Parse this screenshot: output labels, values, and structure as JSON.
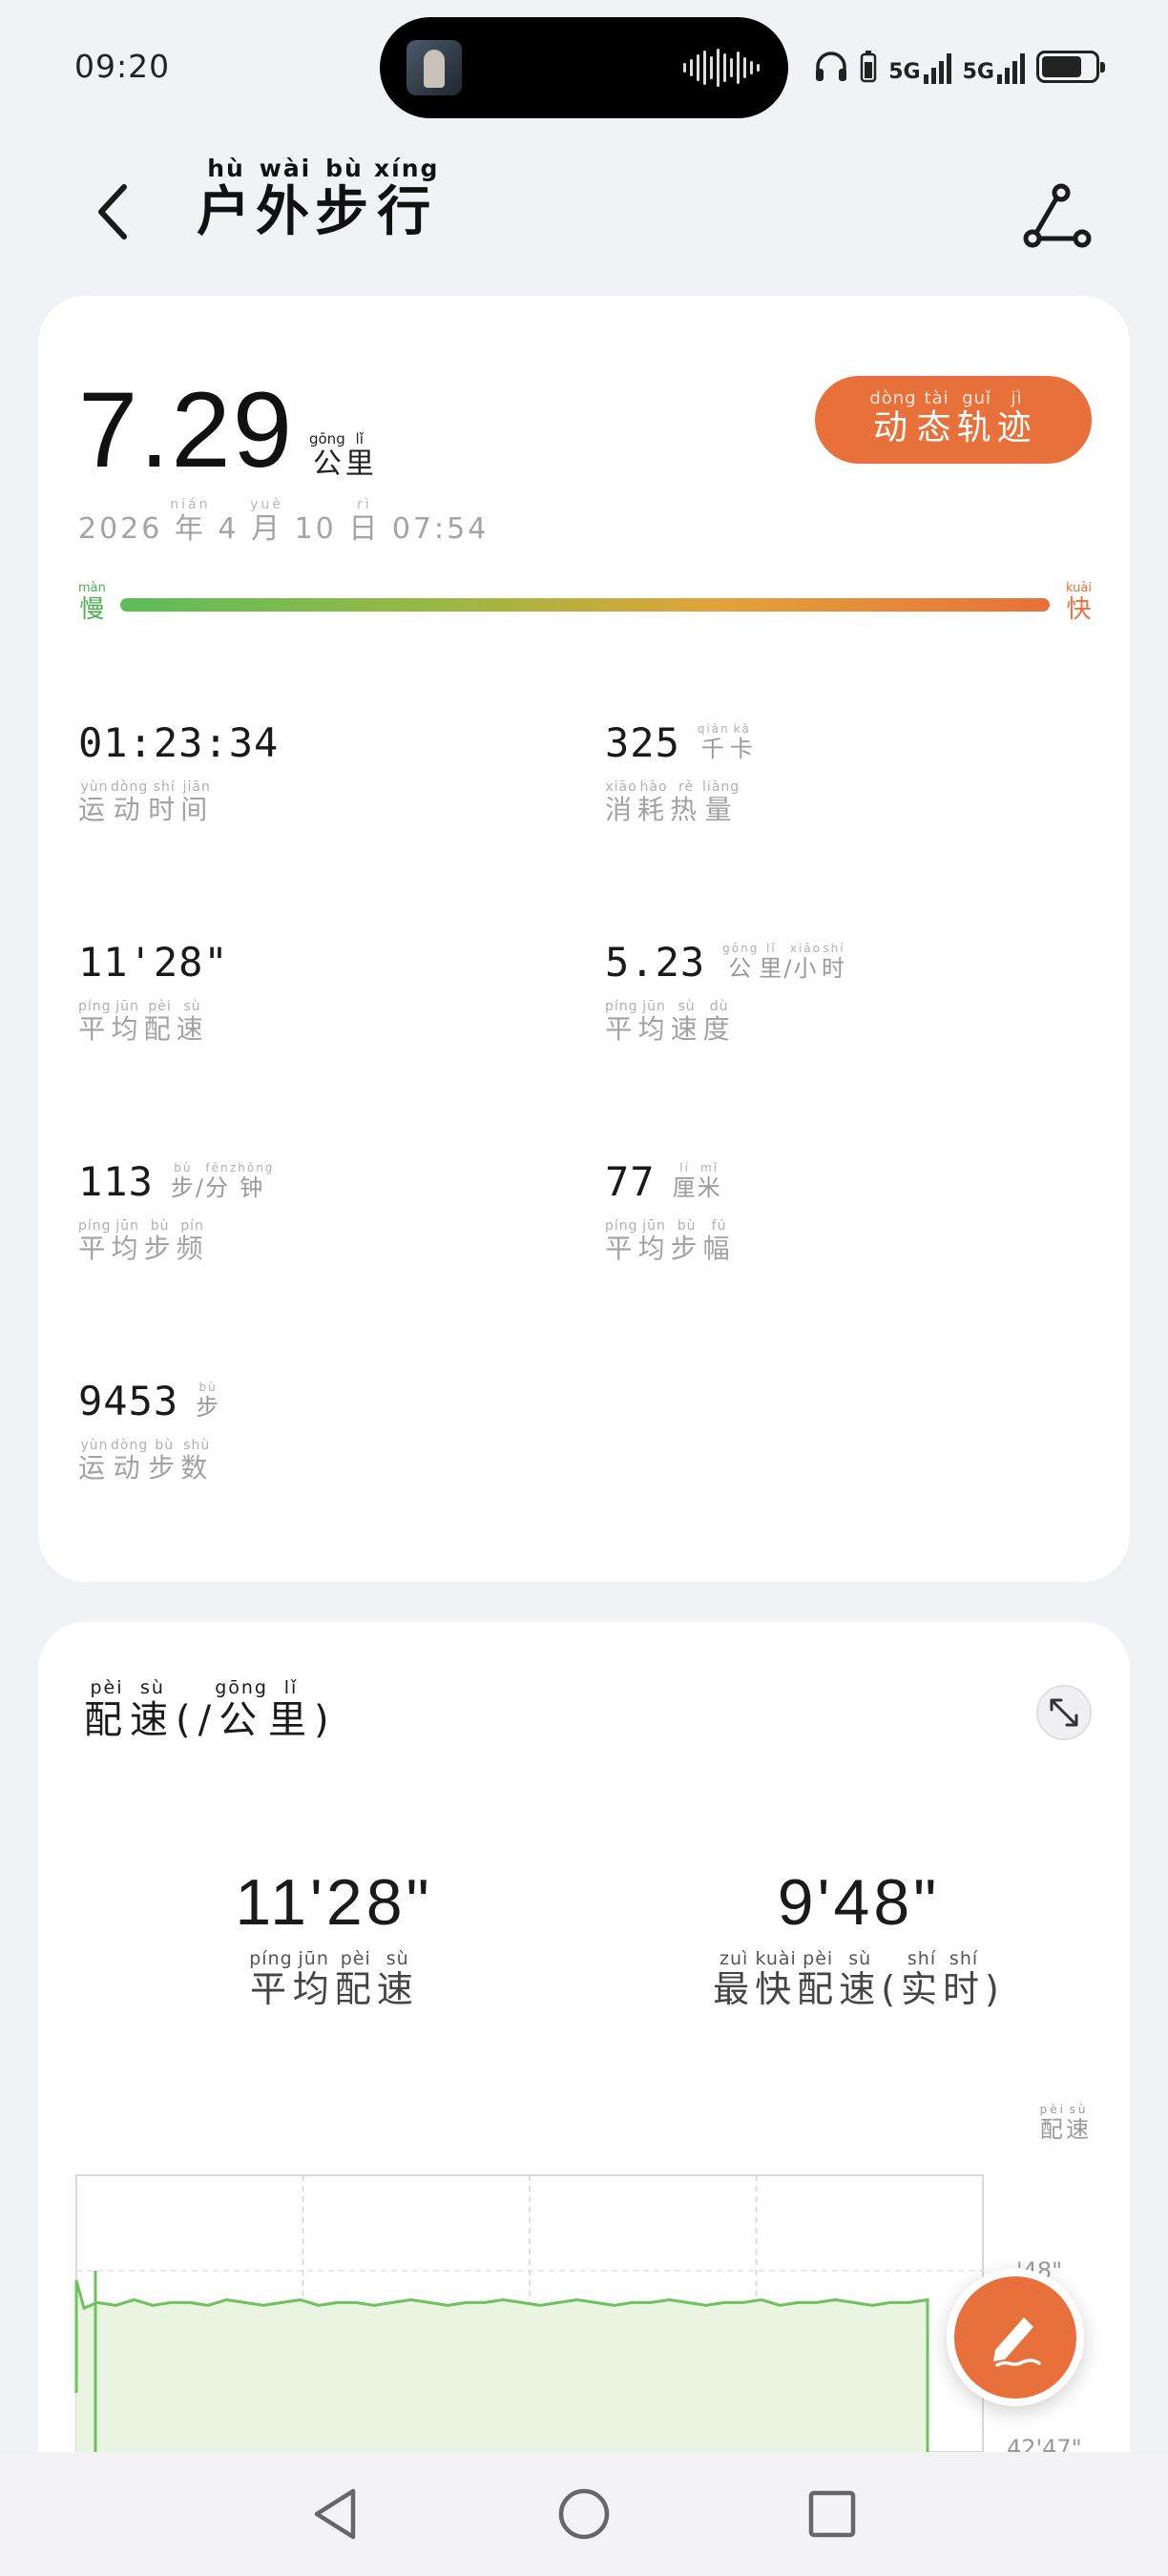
{
  "status_bar": {
    "time": "09:20",
    "network_1": "5G",
    "network_2": "5G",
    "battery_level": 0.75,
    "icons": [
      "headphones-icon",
      "battery-small-icon",
      "signal-icon",
      "signal-icon",
      "battery-icon"
    ]
  },
  "header": {
    "title": [
      {
        "char": "户",
        "pinyin": "hù"
      },
      {
        "char": "外",
        "pinyin": "wài"
      },
      {
        "char": "步",
        "pinyin": "bù"
      },
      {
        "char": "行",
        "pinyin": "xíng"
      }
    ],
    "back_icon": "chevron-left-icon",
    "share_icon": "route-share-icon"
  },
  "summary": {
    "distance": "7.29",
    "distance_unit": [
      {
        "char": "公",
        "pinyin": "gōng"
      },
      {
        "char": "里",
        "pinyin": "lǐ"
      }
    ],
    "track_button": [
      {
        "char": "动",
        "pinyin": "dòng"
      },
      {
        "char": "态",
        "pinyin": "tài"
      },
      {
        "char": "轨",
        "pinyin": "guǐ"
      },
      {
        "char": "迹",
        "pinyin": "jì"
      }
    ],
    "date": [
      {
        "char": "2026 ",
        "pinyin": ""
      },
      {
        "char": "年",
        "pinyin": "nián"
      },
      {
        "char": " 4 ",
        "pinyin": ""
      },
      {
        "char": "月",
        "pinyin": "yuè"
      },
      {
        "char": " 10 ",
        "pinyin": ""
      },
      {
        "char": "日",
        "pinyin": "rì"
      },
      {
        "char": " 07:54",
        "pinyin": ""
      }
    ],
    "speed_slow": {
      "char": "慢",
      "pinyin": "màn"
    },
    "speed_fast": {
      "char": "快",
      "pinyin": "kuài"
    },
    "colors": {
      "slow": "#4caf50",
      "fast": "#e8703a",
      "accent": "#e8703a"
    }
  },
  "metrics": [
    {
      "value": "01:23:34",
      "unit": [],
      "label": [
        {
          "char": "运",
          "pinyin": "yùn"
        },
        {
          "char": "动",
          "pinyin": "dòng"
        },
        {
          "char": "时",
          "pinyin": "shí"
        },
        {
          "char": "间",
          "pinyin": "jiān"
        }
      ]
    },
    {
      "value": "325",
      "unit": [
        {
          "char": "千",
          "pinyin": "qiān"
        },
        {
          "char": "卡",
          "pinyin": "kǎ"
        }
      ],
      "label": [
        {
          "char": "消",
          "pinyin": "xiāo"
        },
        {
          "char": "耗",
          "pinyin": "hào"
        },
        {
          "char": "热",
          "pinyin": "rè"
        },
        {
          "char": "量",
          "pinyin": "liàng"
        }
      ]
    },
    {
      "value": "11'28\"",
      "unit": [],
      "label": [
        {
          "char": "平",
          "pinyin": "píng"
        },
        {
          "char": "均",
          "pinyin": "jūn"
        },
        {
          "char": "配",
          "pinyin": "pèi"
        },
        {
          "char": "速",
          "pinyin": "sù"
        }
      ]
    },
    {
      "value": "5.23",
      "unit": [
        {
          "char": "公",
          "pinyin": "gōng"
        },
        {
          "char": "里",
          "pinyin": "lǐ"
        },
        {
          "char": "/",
          "pinyin": ""
        },
        {
          "char": "小",
          "pinyin": "xiǎo"
        },
        {
          "char": "时",
          "pinyin": "shí"
        }
      ],
      "label": [
        {
          "char": "平",
          "pinyin": "píng"
        },
        {
          "char": "均",
          "pinyin": "jūn"
        },
        {
          "char": "速",
          "pinyin": "sù"
        },
        {
          "char": "度",
          "pinyin": "dù"
        }
      ]
    },
    {
      "value": "113",
      "unit": [
        {
          "char": "步",
          "pinyin": "bù"
        },
        {
          "char": "/",
          "pinyin": ""
        },
        {
          "char": "分",
          "pinyin": "fēn"
        },
        {
          "char": "钟",
          "pinyin": "zhōng"
        }
      ],
      "label": [
        {
          "char": "平",
          "pinyin": "píng"
        },
        {
          "char": "均",
          "pinyin": "jūn"
        },
        {
          "char": "步",
          "pinyin": "bù"
        },
        {
          "char": "频",
          "pinyin": "pín"
        }
      ]
    },
    {
      "value": "77",
      "unit": [
        {
          "char": "厘",
          "pinyin": "lí"
        },
        {
          "char": "米",
          "pinyin": "mǐ"
        }
      ],
      "label": [
        {
          "char": "平",
          "pinyin": "píng"
        },
        {
          "char": "均",
          "pinyin": "jūn"
        },
        {
          "char": "步",
          "pinyin": "bù"
        },
        {
          "char": "幅",
          "pinyin": "fú"
        }
      ]
    },
    {
      "value": "9453",
      "unit": [
        {
          "char": "步",
          "pinyin": "bù"
        }
      ],
      "label": [
        {
          "char": "运",
          "pinyin": "yùn"
        },
        {
          "char": "动",
          "pinyin": "dòng"
        },
        {
          "char": "步",
          "pinyin": "bù"
        },
        {
          "char": "数",
          "pinyin": "shù"
        }
      ]
    }
  ],
  "pace": {
    "title": [
      {
        "char": "配",
        "pinyin": "pèi"
      },
      {
        "char": "速",
        "pinyin": "sù"
      },
      {
        "char": "(/",
        "pinyin": ""
      },
      {
        "char": "公",
        "pinyin": "gōng"
      },
      {
        "char": "里",
        "pinyin": "lǐ"
      },
      {
        "char": ")",
        "pinyin": ""
      }
    ],
    "avg_value": "11'28\"",
    "avg_label": [
      {
        "char": "平",
        "pinyin": "píng"
      },
      {
        "char": "均",
        "pinyin": "jūn"
      },
      {
        "char": "配",
        "pinyin": "pèi"
      },
      {
        "char": "速",
        "pinyin": "sù"
      }
    ],
    "best_value": "9'48\"",
    "best_label": [
      {
        "char": "最",
        "pinyin": "zuì"
      },
      {
        "char": "快",
        "pinyin": "kuài"
      },
      {
        "char": "配",
        "pinyin": "pèi"
      },
      {
        "char": "速",
        "pinyin": "sù"
      },
      {
        "char": "(",
        "pinyin": ""
      },
      {
        "char": "实",
        "pinyin": "shí"
      },
      {
        "char": "时",
        "pinyin": "shí"
      },
      {
        "char": ")",
        "pinyin": ""
      }
    ],
    "y_axis_label": [
      {
        "char": "配",
        "pinyin": "pèi"
      },
      {
        "char": "速",
        "pinyin": "sù"
      }
    ],
    "tick_labels": [
      "'48\"",
      "42'47\""
    ],
    "expand_icon": "expand-diagonal-icon"
  },
  "chart_data": {
    "type": "area",
    "title": "",
    "xlabel": "",
    "ylabel": "配速",
    "grid": true,
    "series": [
      {
        "values": [
          0.54,
          0.53,
          0.55,
          0.53,
          0.54,
          0.54,
          0.53,
          0.55,
          0.54,
          0.53,
          0.54,
          0.55,
          0.53,
          0.54,
          0.54,
          0.53,
          0.54,
          0.55,
          0.54,
          0.53,
          0.54,
          0.54,
          0.55,
          0.54,
          0.53,
          0.54,
          0.55,
          0.54,
          0.53,
          0.54,
          0.54,
          0.55,
          0.54,
          0.53,
          0.54,
          0.54,
          0.55,
          0.53,
          0.54,
          0.54,
          0.55,
          0.54,
          0.53,
          0.54,
          0.54,
          0.55
        ]
      }
    ],
    "colors": {
      "line": "#6cc35c",
      "fill": "#eaf6e1"
    }
  },
  "fab": {
    "icon": "edit-pen-icon"
  },
  "nav_bar": {
    "icons": [
      "back-triangle-icon",
      "home-circle-icon",
      "recents-square-icon"
    ]
  }
}
